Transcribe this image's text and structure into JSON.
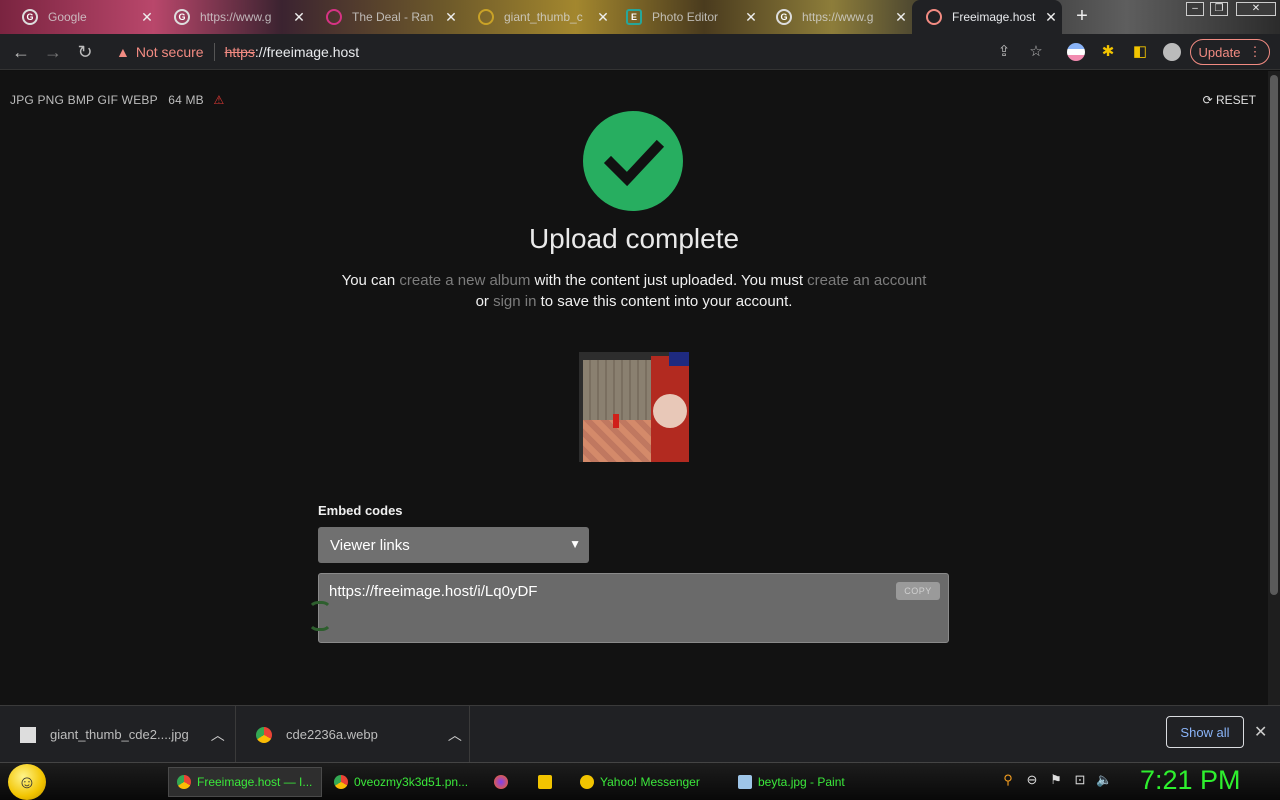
{
  "browser": {
    "tabs": [
      {
        "title": "Google",
        "active": false
      },
      {
        "title": "https://www.g",
        "active": false
      },
      {
        "title": "The Deal - Ran",
        "active": false
      },
      {
        "title": "giant_thumb_c",
        "active": false
      },
      {
        "title": "Photo Editor",
        "active": false
      },
      {
        "title": "https://www.g",
        "active": false
      },
      {
        "title": "Freeimage.host",
        "active": true
      }
    ],
    "security_label": "Not secure",
    "url_scheme": "https",
    "url_rest": "://freeimage.host",
    "update_label": "Update"
  },
  "page": {
    "formats": "JPG PNG BMP GIF WEBP",
    "max_size": "64 MB",
    "reset_label": "RESET",
    "title": "Upload complete",
    "msg": {
      "p1": "You can ",
      "link_album": "create a new album",
      "p2": " with the content just uploaded. You must ",
      "link_account": "create an account",
      "p3": " or ",
      "link_signin": "sign in",
      "p4": " to save this content into your account."
    },
    "embed": {
      "label": "Embed codes",
      "selected": "Viewer links",
      "code": "https://freeimage.host/i/Lq0yDF",
      "copy_label": "COPY"
    }
  },
  "downloads": {
    "items": [
      {
        "name": "giant_thumb_cde2....jpg"
      },
      {
        "name": "cde2236a.webp"
      }
    ],
    "show_all_label": "Show all"
  },
  "taskbar": {
    "items": [
      {
        "label": "Freeimage.host — I..."
      },
      {
        "label": "0veozmy3k3d51.pn..."
      },
      {
        "label": ""
      },
      {
        "label": ""
      },
      {
        "label": "Yahoo! Messenger"
      },
      {
        "label": "beyta.jpg - Paint"
      }
    ],
    "clock": "7:21 PM"
  },
  "colors": {
    "accent_green": "#27ae60",
    "warning_red": "#f28b82",
    "link_gray": "#7c7c7c",
    "clock_green": "#2ef02e"
  }
}
